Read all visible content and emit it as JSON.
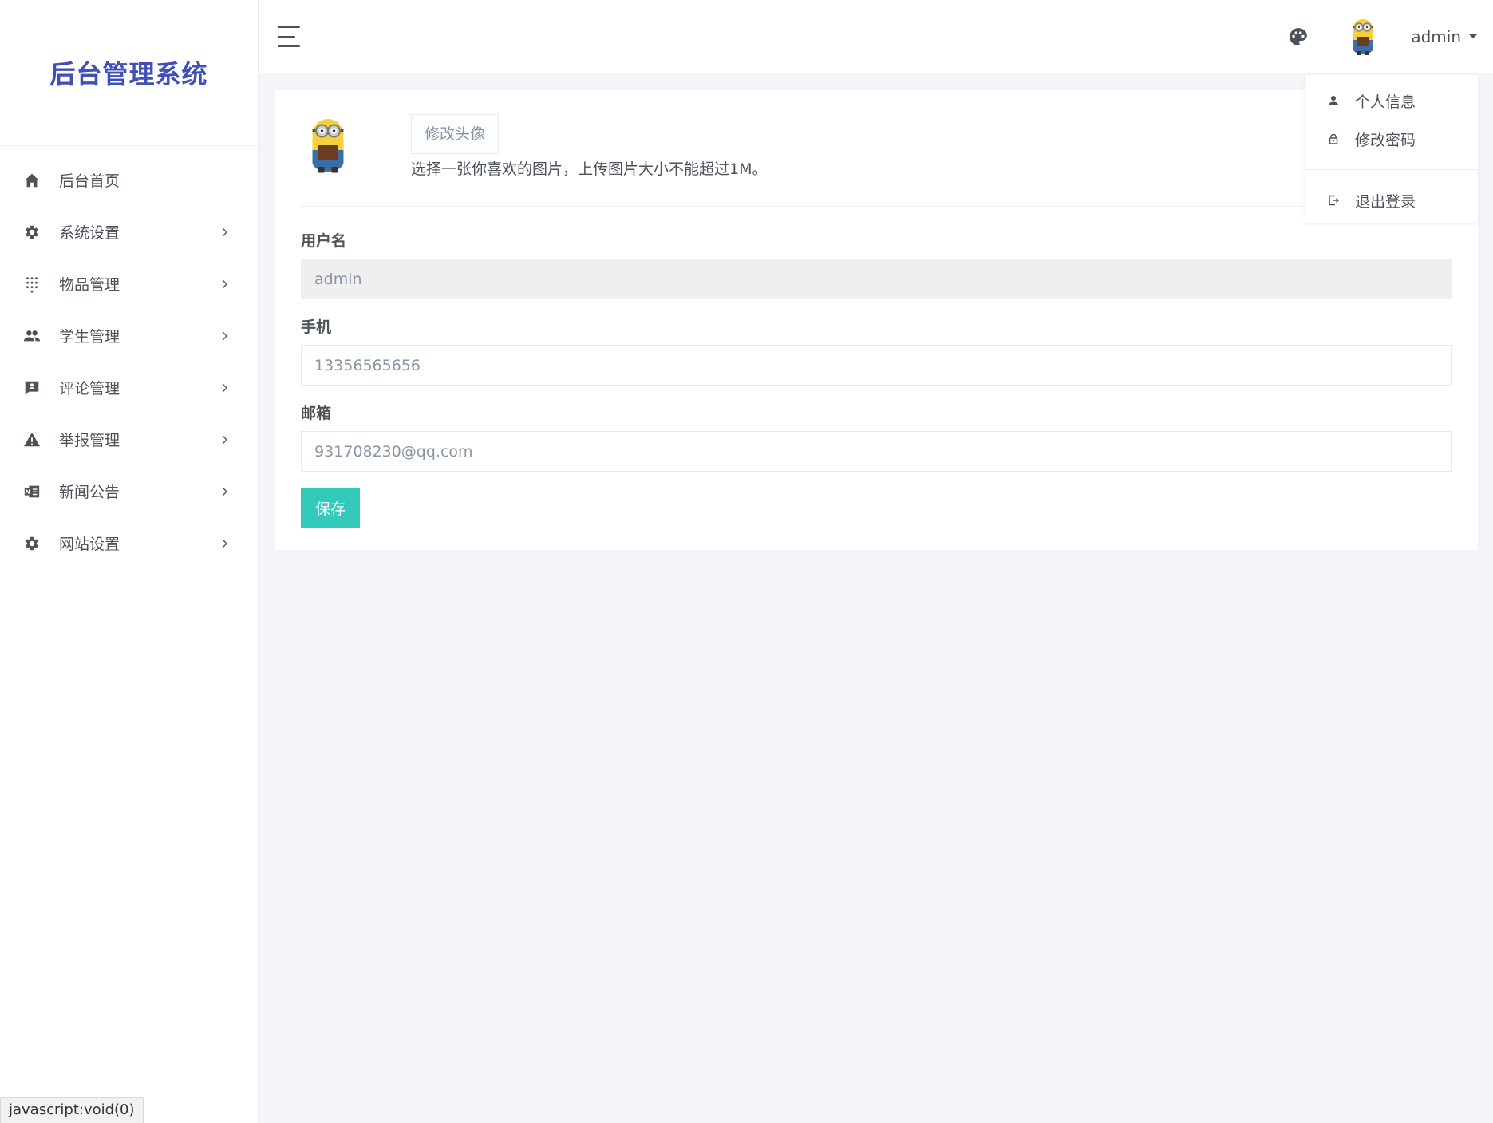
{
  "brand": {
    "title": "后台管理系统",
    "color": "#3f51b5"
  },
  "sidebar": {
    "items": [
      {
        "label": "后台首页",
        "icon": "home-icon",
        "has_submenu": false
      },
      {
        "label": "系统设置",
        "icon": "gear-icon",
        "has_submenu": true
      },
      {
        "label": "物品管理",
        "icon": "grid-dots-icon",
        "has_submenu": true
      },
      {
        "label": "学生管理",
        "icon": "users-icon",
        "has_submenu": true
      },
      {
        "label": "评论管理",
        "icon": "comment-icon",
        "has_submenu": true
      },
      {
        "label": "举报管理",
        "icon": "warning-icon",
        "has_submenu": true
      },
      {
        "label": "新闻公告",
        "icon": "news-icon",
        "has_submenu": true
      },
      {
        "label": "网站设置",
        "icon": "gear-icon",
        "has_submenu": true
      }
    ]
  },
  "header": {
    "username": "admin",
    "icons": [
      "menu-icon",
      "palette-icon",
      "avatar"
    ]
  },
  "dropdown": {
    "items": [
      {
        "label": "个人信息",
        "icon": "user-icon"
      },
      {
        "label": "修改密码",
        "icon": "lock-icon"
      },
      {
        "label": "退出登录",
        "icon": "logout-icon"
      }
    ]
  },
  "profile": {
    "change_avatar_label": "修改头像",
    "avatar_hint": "选择一张你喜欢的图片，上传图片大小不能超过1M。",
    "fields": {
      "username_label": "用户名",
      "username_value": "admin",
      "phone_label": "手机",
      "phone_value": "13356565656",
      "email_label": "邮箱",
      "email_value": "931708230@qq.com"
    },
    "save_label": "保存"
  },
  "status_bar": {
    "text": "javascript:void(0)"
  },
  "colors": {
    "accent": "#33cabb",
    "brand": "#3f51b5",
    "text": "#4d5259",
    "muted": "#8b95a5",
    "background": "#f4f5f8"
  }
}
